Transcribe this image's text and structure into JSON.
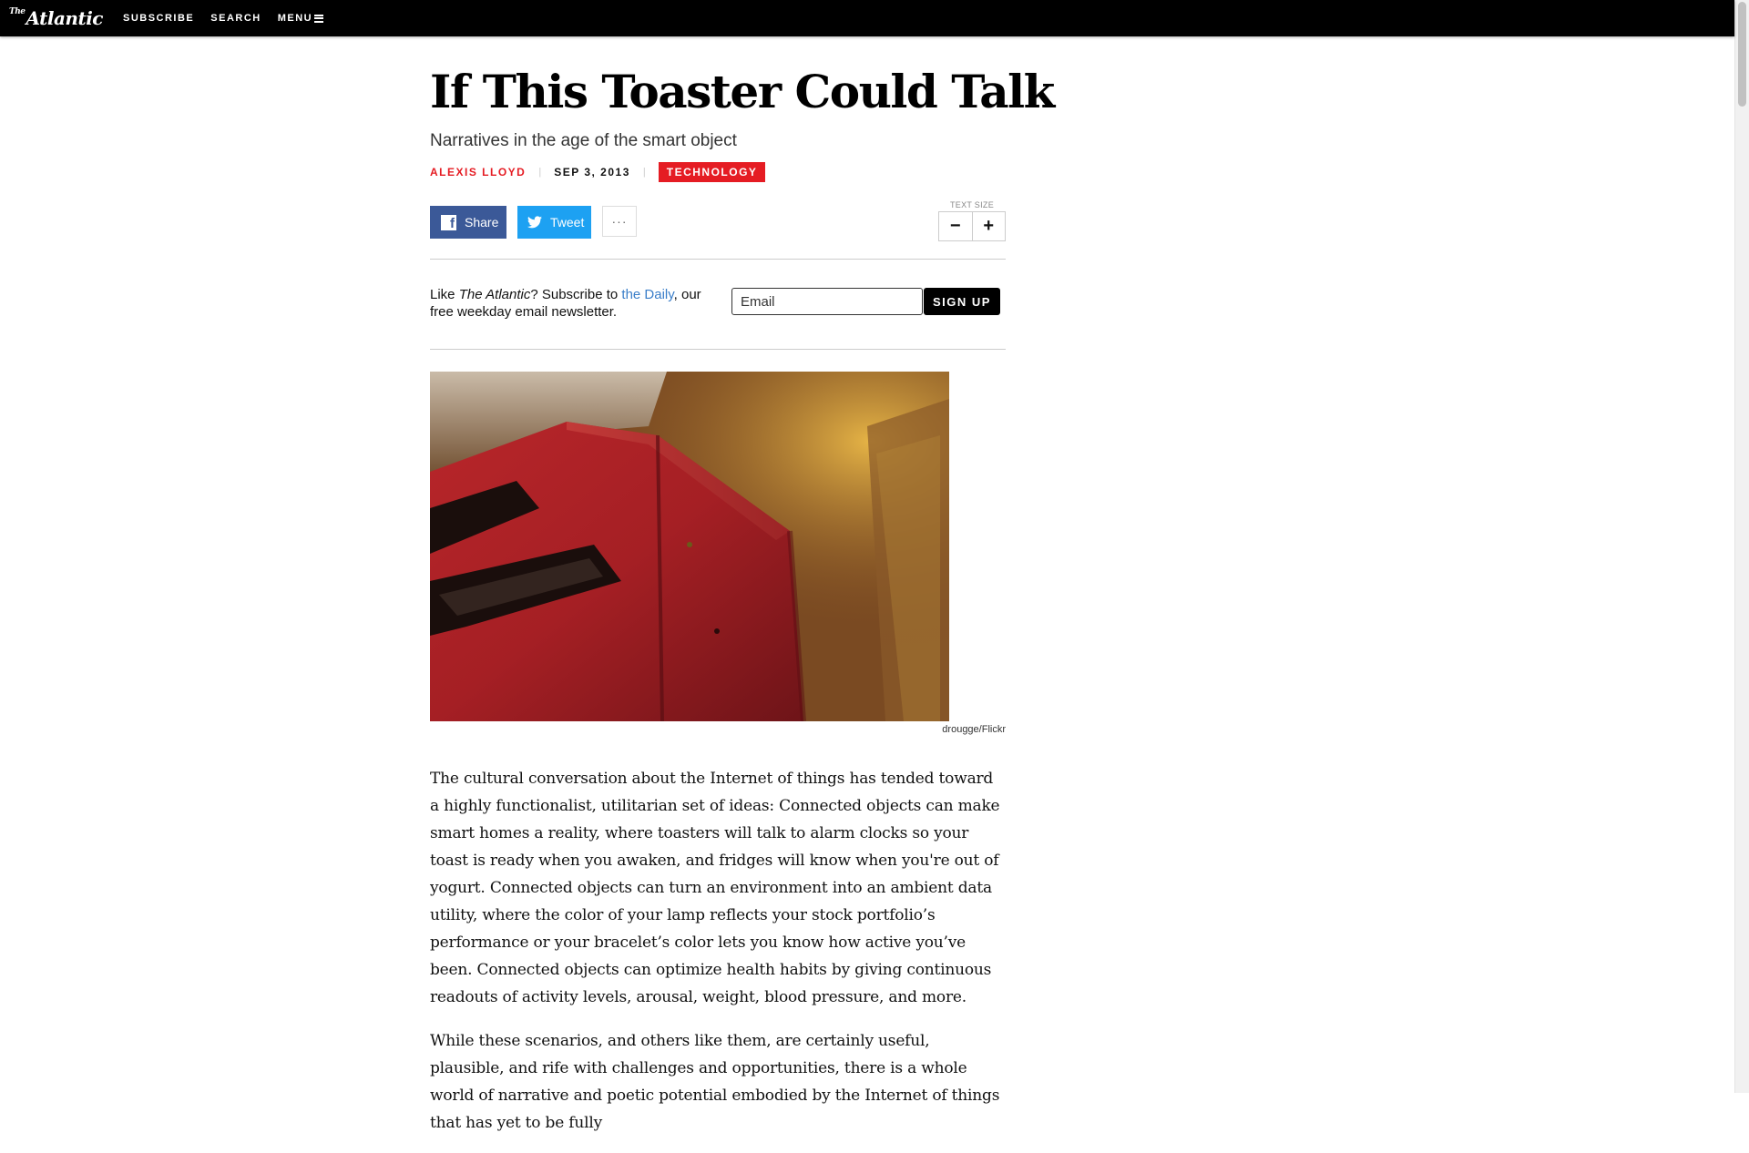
{
  "nav": {
    "logo_small": "The",
    "logo_main": "Atlantic",
    "subscribe": "SUBSCRIBE",
    "search": "SEARCH",
    "menu": "MENU"
  },
  "article": {
    "headline": "If This Toaster Could Talk",
    "dek": "Narratives in the age of the smart object",
    "author": "ALEXIS LLOYD",
    "date": "SEP 3, 2013",
    "section": "TECHNOLOGY"
  },
  "share": {
    "facebook_label": "Share",
    "twitter_label": "Tweet",
    "more_label": "···",
    "text_size_label": "TEXT SIZE",
    "decrease": "−",
    "increase": "+"
  },
  "newsletter": {
    "text_before": "Like ",
    "brand": "The Atlantic",
    "text_mid": "? Subscribe to ",
    "link": "the Daily",
    "text_after": ", our free weekday email newsletter.",
    "email_placeholder": "Email",
    "signup_label": "SIGN UP"
  },
  "lead_image": {
    "credit": "drougge/Flickr"
  },
  "body": {
    "paragraphs": [
      "The cultural conversation about the Internet of things has tended toward a highly functionalist, utilitarian set of ideas: Connected objects can make smart homes a reality, where toasters will talk to alarm clocks so your toast is ready when you awaken, and fridges will know when you're out of yogurt. Connected objects can turn an environment into an ambient data utility, where the color of your lamp reflects your stock portfolio’s performance or your bracelet’s color lets you know how active you’ve been.  Connected objects can optimize health habits by giving continuous readouts of activity levels, arousal, weight, blood pressure, and more.",
      "While these scenarios, and others like them, are certainly useful, plausible, and rife with challenges and opportunities, there is a whole world of narrative and poetic potential embodied by the Internet of things that has yet to be fully"
    ]
  },
  "colors": {
    "accent_red": "#e51c23",
    "facebook_blue": "#3b5998",
    "twitter_blue": "#1da1f2",
    "link_blue": "#3a7ec9"
  },
  "icons": {
    "facebook": "facebook-icon",
    "twitter": "twitter-icon",
    "menu": "hamburger-icon"
  }
}
